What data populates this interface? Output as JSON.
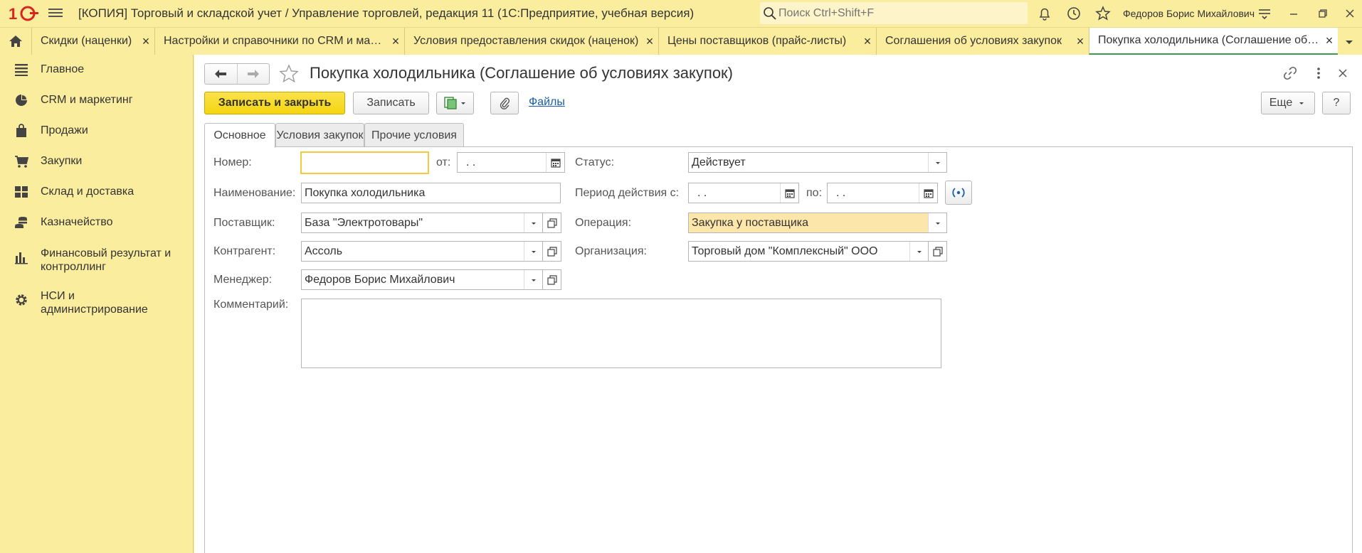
{
  "app": {
    "title": "[КОПИЯ] Торговый и складской учет / Управление торговлей, редакция 11  (1С:Предприятие, учебная версия)",
    "search_placeholder": "Поиск Ctrl+Shift+F",
    "user": "Федоров Борис Михайлович"
  },
  "tabs": [
    {
      "label": "Скидки (наценки)"
    },
    {
      "label": "Настройки и справочники по CRM и маркетингу"
    },
    {
      "label": "Условия предоставления скидок (наценок)"
    },
    {
      "label": "Цены поставщиков (прайс-листы)"
    },
    {
      "label": "Соглашения об условиях закупок"
    },
    {
      "label": "Покупка холодильника (Соглашение об условиях закупок)"
    }
  ],
  "sidebar": {
    "items": [
      {
        "label": "Главное",
        "icon": "menu-lines-icon"
      },
      {
        "label": "CRM и маркетинг",
        "icon": "pie-chart-icon"
      },
      {
        "label": "Продажи",
        "icon": "shopping-bag-icon"
      },
      {
        "label": "Закупки",
        "icon": "cart-icon"
      },
      {
        "label": "Склад и доставка",
        "icon": "warehouse-grid-icon"
      },
      {
        "label": "Казначейство",
        "icon": "coins-icon"
      },
      {
        "label": "Финансовый результат и",
        "label2": "контроллинг",
        "icon": "bar-chart-icon"
      },
      {
        "label": "НСИ и",
        "label2": "администрирование",
        "icon": "gear-icon"
      }
    ]
  },
  "form": {
    "title": "Покупка холодильника (Соглашение об условиях закупок)",
    "save_close_label": "Записать и закрыть",
    "save_label": "Записать",
    "files_label": "Файлы",
    "more_label": "Еще",
    "help_label": "?",
    "tabs": [
      "Основное",
      "Условия закупок",
      "Прочие условия"
    ],
    "fields": {
      "number_label": "Номер:",
      "number_value": "",
      "from_label": "от:",
      "from_value": " .  .",
      "status_label": "Статус:",
      "status_value": "Действует",
      "name_label": "Наименование:",
      "name_value": "Покупка холодильника",
      "period_label": "Период действия с:",
      "period_from_value": " .  .",
      "period_to_label": "по:",
      "period_to_value": " .  .",
      "supplier_label": "Поставщик:",
      "supplier_value": "База \"Электротовары\"",
      "operation_label": "Операция:",
      "operation_value": "Закупка у поставщика",
      "counterparty_label": "Контрагент:",
      "counterparty_value": "Ассоль",
      "organization_label": "Организация:",
      "organization_value": "Торговый дом \"Комплексный\" ООО",
      "manager_label": "Менеджер:",
      "manager_value": "Федоров Борис Михайлович",
      "comment_label": "Комментарий:",
      "comment_value": ""
    }
  },
  "colors": {
    "panel_yellow": "#fbed9e",
    "primary_button": "#f5d50f",
    "active_tab_underline": "#3d9a52",
    "link": "#1a5ea8",
    "highlight_field": "#fde6a9",
    "brand_red": "#d7261e"
  }
}
